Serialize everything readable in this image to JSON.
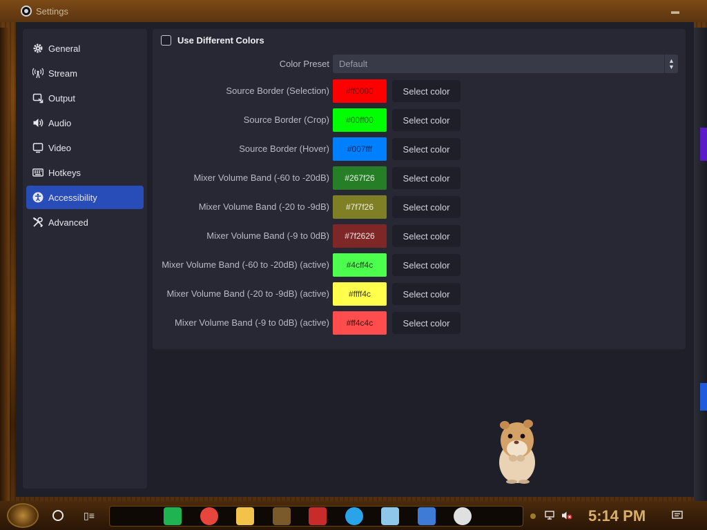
{
  "window": {
    "title": "Settings"
  },
  "sidebar": {
    "items": [
      {
        "label": "General",
        "icon": "gear-icon"
      },
      {
        "label": "Stream",
        "icon": "broadcast-icon"
      },
      {
        "label": "Output",
        "icon": "output-icon"
      },
      {
        "label": "Audio",
        "icon": "speaker-icon"
      },
      {
        "label": "Video",
        "icon": "monitor-icon"
      },
      {
        "label": "Hotkeys",
        "icon": "keyboard-icon"
      },
      {
        "label": "Accessibility",
        "icon": "accessibility-icon",
        "active": true
      },
      {
        "label": "Advanced",
        "icon": "tools-icon"
      }
    ]
  },
  "accessibility": {
    "use_different_colors": {
      "label": "Use Different Colors",
      "checked": false
    },
    "color_preset": {
      "label": "Color Preset",
      "value": "Default"
    },
    "select_label": "Select color",
    "colors": [
      {
        "label": "Source Border (Selection)",
        "value": "#ff0000",
        "bg": "#ff0000",
        "fg": "#7a0000"
      },
      {
        "label": "Source Border (Crop)",
        "value": "#00ff00",
        "bg": "#00ff00",
        "fg": "#006a00"
      },
      {
        "label": "Source Border (Hover)",
        "value": "#007fff",
        "bg": "#007fff",
        "fg": "#0a2a5a"
      },
      {
        "label": "Mixer Volume Band (-60 to -20dB)",
        "value": "#267f26",
        "bg": "#267f26",
        "fg": "#e8f0e8"
      },
      {
        "label": "Mixer Volume Band (-20 to -9dB)",
        "value": "#7f7f26",
        "bg": "#7f7f26",
        "fg": "#f0f0e0"
      },
      {
        "label": "Mixer Volume Band (-9 to 0dB)",
        "value": "#7f2626",
        "bg": "#7f2626",
        "fg": "#f2e6e6"
      },
      {
        "label": "Mixer Volume Band (-60 to -20dB) (active)",
        "value": "#4cff4c",
        "bg": "#4cff4c",
        "fg": "#1e3a1e"
      },
      {
        "label": "Mixer Volume Band (-20 to -9dB) (active)",
        "value": "#ffff4c",
        "bg": "#ffff4c",
        "fg": "#3a3a10"
      },
      {
        "label": "Mixer Volume Band (-9 to 0dB) (active)",
        "value": "#ff4c4c",
        "bg": "#ff4c4c",
        "fg": "#3a1010"
      }
    ]
  },
  "taskbar": {
    "clock": "5:14 PM",
    "apps": [
      {
        "name": "chat-app-icon",
        "color": "#1fb351"
      },
      {
        "name": "chrome-icon",
        "color": "#e8453c"
      },
      {
        "name": "file-explorer-icon",
        "color": "#f3c24a"
      },
      {
        "name": "clock-widget-icon",
        "color": "#7a5a2a"
      },
      {
        "name": "media-player-icon",
        "color": "#c92b2b"
      },
      {
        "name": "edge-icon",
        "color": "#2aa4e8"
      },
      {
        "name": "notes-icon",
        "color": "#8fc7ea"
      },
      {
        "name": "remote-desktop-icon",
        "color": "#3d7bd6"
      },
      {
        "name": "obs-icon",
        "color": "#e0e0e0"
      }
    ]
  }
}
